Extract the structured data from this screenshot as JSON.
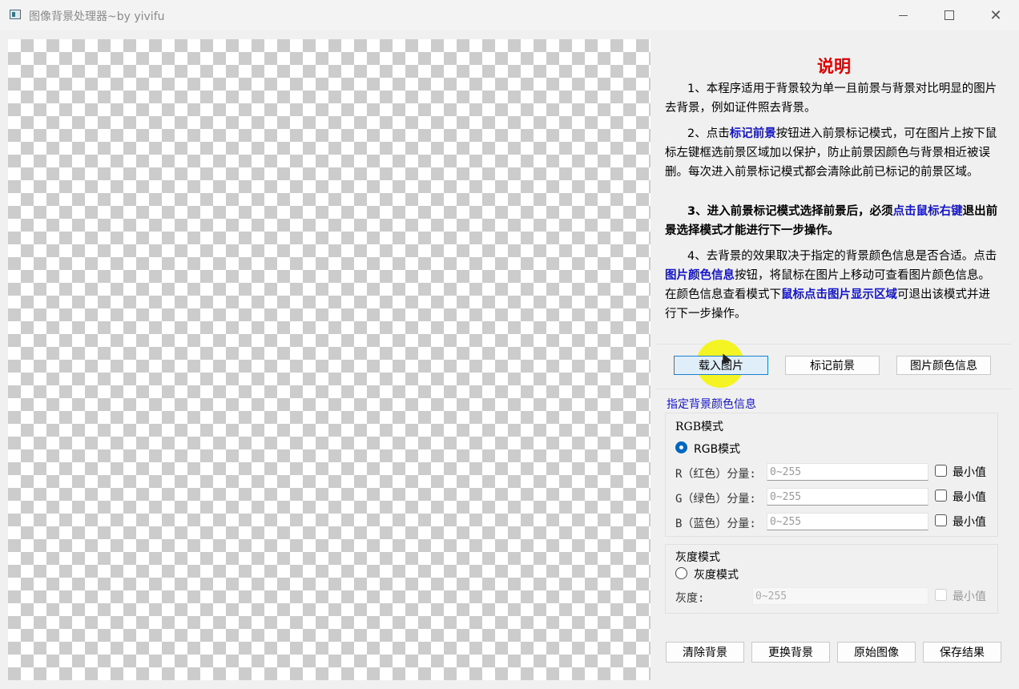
{
  "window": {
    "title": "图像背景处理器~by yivifu",
    "icon": "app-icon",
    "controls": {
      "minimize": "—",
      "maximize": "",
      "close": "✕"
    }
  },
  "help": {
    "title": "说明",
    "p1": "1、本程序适用于背景较为单一且前景与背景对比明显的图片去背景，例如证件照去背景。",
    "p2_a": "2、点击",
    "p2_hl": "标记前景",
    "p2_b": "按钮进入前景标记模式，可在图片上按下鼠标左键框选前景区域加以保护，防止前景因颜色与背景相近被误删。每次进入前景标记模式都会清除此前已标记的前景区域。",
    "p3_a": "3、进入前景标记模式选择前景后，必须",
    "p3_hl": "点击鼠标右键",
    "p3_b": "退出前景选择模式才能进行下一步操作。",
    "p4_a": "4、去背景的效果取决于指定的背景颜色信息是否合适。点击",
    "p4_hl1": "图片颜色信息",
    "p4_b": "按钮，将鼠标在图片上移动可查看图片颜色信息。在颜色信息查看模式下",
    "p4_hl2": "鼠标点击图片显示区域",
    "p4_c": "可退出该模式并进行下一步操作。"
  },
  "buttons": {
    "load": "载入图片",
    "mark": "标记前景",
    "color_info": "图片颜色信息"
  },
  "bg_group": {
    "title": "指定背景颜色信息",
    "rgb": {
      "group_label": "RGB模式",
      "radio_label": "RGB模式",
      "radio_checked": true,
      "r_label": "R（红色）分量:",
      "g_label": "G（绿色）分量:",
      "b_label": "B（蓝色）分量:",
      "placeholder": "0~255",
      "min_label": "最小值"
    },
    "gray": {
      "group_label": "灰度模式",
      "radio_label": "灰度模式",
      "radio_checked": false,
      "field_label": "灰度:",
      "placeholder": "0~255",
      "min_label": "最小值"
    }
  },
  "bottom_buttons": {
    "clear": "清除背景",
    "replace": "更换背景",
    "original": "原始图像",
    "save": "保存结果"
  },
  "colors": {
    "accent": "#0067c0",
    "highlight_text": "#1515c8",
    "help_title": "#e00000",
    "cursor_highlight": "#f5f500"
  }
}
